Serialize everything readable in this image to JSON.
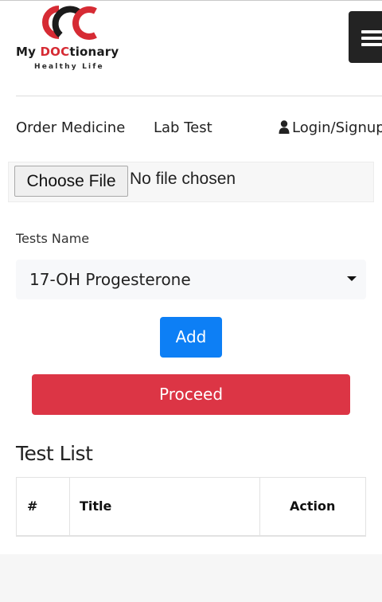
{
  "brand": {
    "name_prefix": "My ",
    "name_accent": "DOC",
    "name_suffix": "tionary",
    "tagline": "Healthy Life",
    "colors": {
      "accent": "#d62b34",
      "dark": "#1b1b1b"
    }
  },
  "header": {
    "menu_icon": "hamburger-icon"
  },
  "nav": {
    "order_medicine": "Order Medicine",
    "lab_test": "Lab Test",
    "login": "Login/Signup",
    "login_icon": "user-icon"
  },
  "upload": {
    "button_label": "Choose File",
    "status": "No file chosen"
  },
  "tests": {
    "label": "Tests Name",
    "selected": "17-OH Progesterone"
  },
  "actions": {
    "add_label": "Add",
    "proceed_label": "Proceed",
    "colors": {
      "add": "#0d7ff5",
      "proceed": "#dc3545"
    }
  },
  "test_list": {
    "title": "Test List",
    "columns": [
      "#",
      "Title",
      "Action"
    ]
  }
}
